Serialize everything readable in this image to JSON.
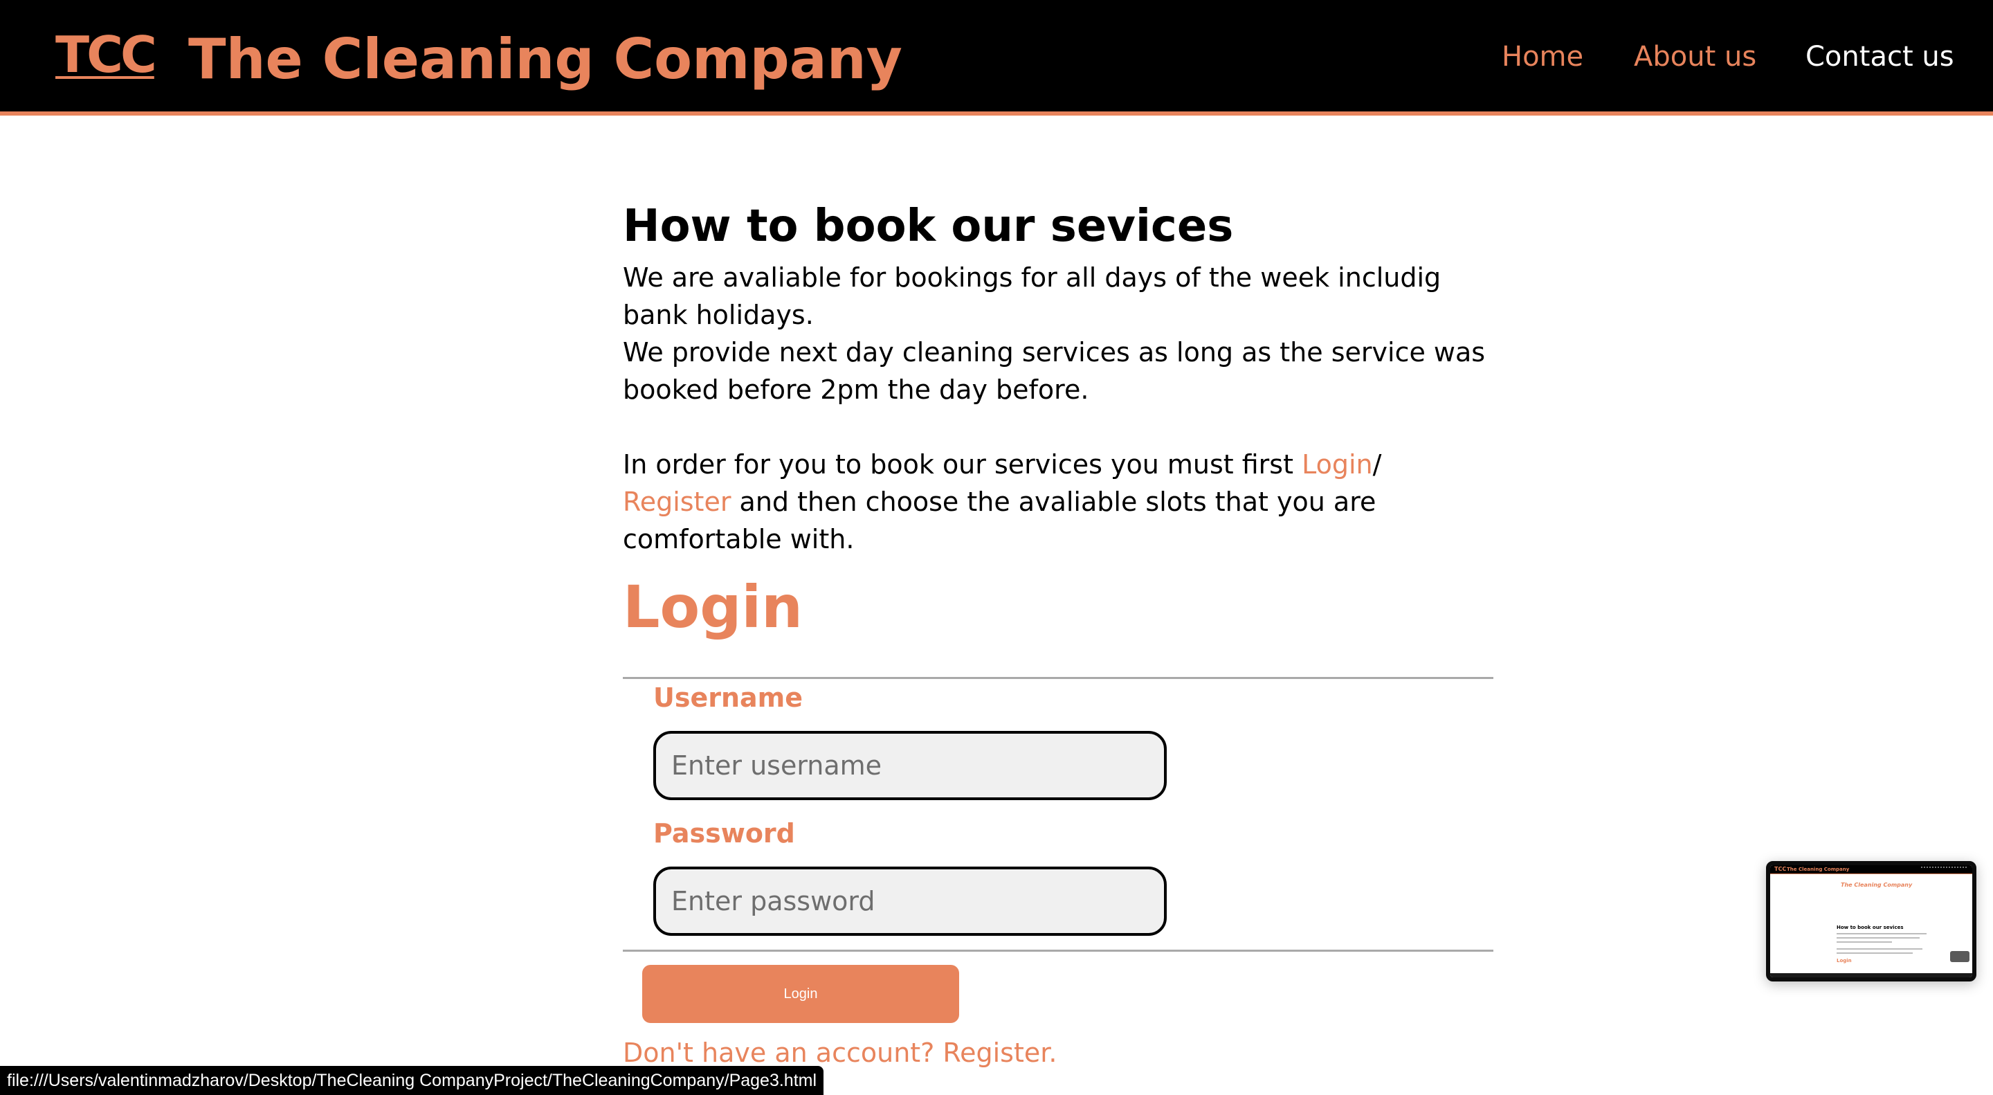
{
  "header": {
    "logo": "TCC",
    "title": "The Cleaning Company",
    "nav": {
      "home": "Home",
      "about": "About us",
      "contact": "Contact us"
    }
  },
  "booking": {
    "heading": "How to book our sevices",
    "line1": "We are avaliable for bookings for all days of the week includig bank holidays.",
    "line2": "We provide next day cleaning services as long as the service was booked before 2pm the day before.",
    "line3_before": "In order for you to book our services you must first ",
    "line3_login": "Login",
    "line3_sep": "/ ",
    "line3_register": "Register",
    "line3_after": " and then choose the avaliable slots that you are comfortable with."
  },
  "login": {
    "title": "Login",
    "username_label": "Username",
    "username_placeholder": "Enter username",
    "password_label": "Password",
    "password_placeholder": "Enter password",
    "button": "Login",
    "register_link": "Don't have an account? Register."
  },
  "status_bar": {
    "url": "file:///Users/valentinmadzharov/Desktop/TheCleaning CompanyProject/TheCleaningCompany/Page3.html"
  },
  "thumbnail": {
    "logo": "TCC",
    "title": "The Cleaning Company",
    "banner": "The Cleaning Company",
    "heading": "How to book our sevices",
    "login": "Login"
  },
  "colors": {
    "accent": "#e8845c",
    "header_bg": "#000000",
    "input_bg": "#f0f0f0"
  }
}
